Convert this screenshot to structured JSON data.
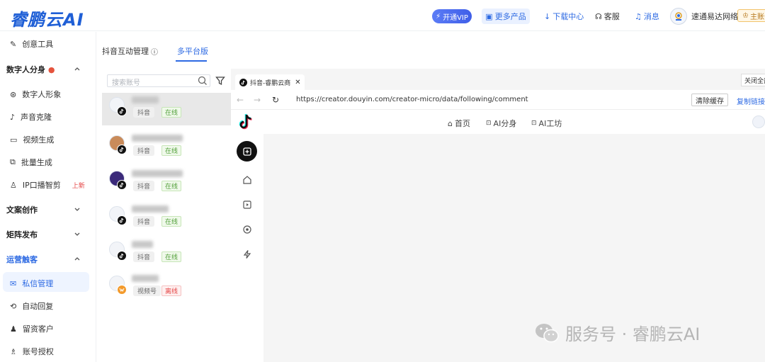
{
  "header": {
    "logo": "睿鹏云AI",
    "vip_label": "开通VIP",
    "more_products": "更多产品",
    "download": "下载中心",
    "service": "客服",
    "messages": "消息",
    "company": "速通易达网络",
    "main_account": "主账号"
  },
  "sidebar": {
    "creative_tools": "创意工具",
    "group_digital": "数字人分身",
    "items_digital": [
      "数字人形象",
      "声音克隆",
      "视频生成",
      "批量生成",
      "IP口播智剪"
    ],
    "new_badge": "上新",
    "group_copy": "文案创作",
    "group_matrix": "矩阵发布",
    "group_ops": "运营触客",
    "items_ops": [
      "私信管理",
      "自动回复",
      "留资客户",
      "账号授权"
    ]
  },
  "tabs": {
    "tab1": "抖音互动管理",
    "tab2": "多平台版"
  },
  "accounts": {
    "search_placeholder": "搜索账号",
    "list": [
      {
        "platform": "抖音",
        "status": "在线"
      },
      {
        "platform": "抖音",
        "status": "在线"
      },
      {
        "platform": "抖音",
        "status": "在线"
      },
      {
        "platform": "抖音",
        "status": "在线"
      },
      {
        "platform": "抖音",
        "status": "在线"
      },
      {
        "platform": "视频号",
        "status": "离线"
      }
    ]
  },
  "browser": {
    "tab_title": "抖音-睿鹏云商",
    "close_all": "关闭全部",
    "url": "https://creator.douyin.com/creator-micro/data/following/comment",
    "clear_cache": "清除缓存",
    "copy_link": "复制链接",
    "nav": [
      "首页",
      "AI分身",
      "AI工坊"
    ]
  },
  "watermark": "服务号 · 睿鹏云AI",
  "colors": {
    "accent": "#2d6ae3",
    "online": "#52a03a",
    "offline": "#e54545"
  }
}
